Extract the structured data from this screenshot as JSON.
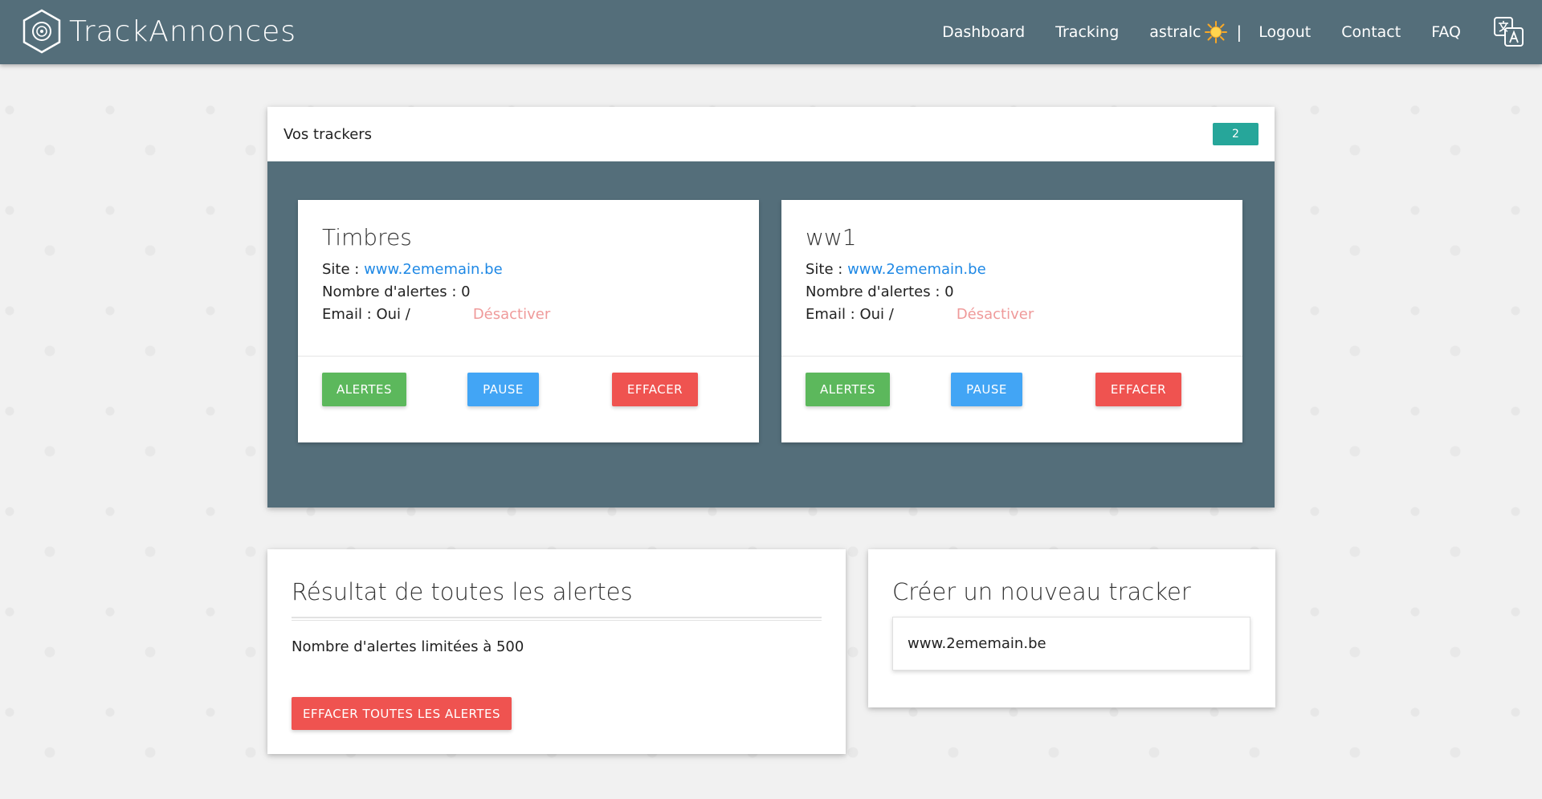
{
  "brand": {
    "name": "TrackAnnonces"
  },
  "nav": {
    "dashboard": "Dashboard",
    "tracking": "Tracking",
    "user": "astralc",
    "separator": "|",
    "logout": "Logout",
    "contact": "Contact",
    "faq": "FAQ"
  },
  "trackers": {
    "title": "Vos trackers",
    "count": "2",
    "items": [
      {
        "name": "Timbres",
        "site_label": "Site : ",
        "site_url": "www.2ememain.be",
        "alerts_label": "Nombre d'alertes : 0",
        "email_label": "Email : Oui /",
        "deactivate": "Désactiver",
        "btn_alerts": "ALERTES",
        "btn_pause": "PAUSE",
        "btn_delete": "EFFACER"
      },
      {
        "name": "ww1",
        "site_label": "Site : ",
        "site_url": "www.2ememain.be",
        "alerts_label": "Nombre d'alertes : 0",
        "email_label": "Email : Oui /",
        "deactivate": "Désactiver",
        "btn_alerts": "ALERTES",
        "btn_pause": "PAUSE",
        "btn_delete": "EFFACER"
      }
    ]
  },
  "results": {
    "title": "Résultat de toutes les alertes",
    "limit_text": "Nombre d'alertes limitées à 500",
    "clear_button": "EFFACER TOUTES LES ALERTES"
  },
  "create": {
    "title": "Créer un nouveau tracker",
    "input_value": "www.2ememain.be"
  },
  "colors": {
    "navbar": "#546e7a",
    "badge": "#26a69a",
    "green": "#5cb85c",
    "blue": "#42a5f5",
    "red": "#ef5350",
    "link": "#1e88e5"
  }
}
